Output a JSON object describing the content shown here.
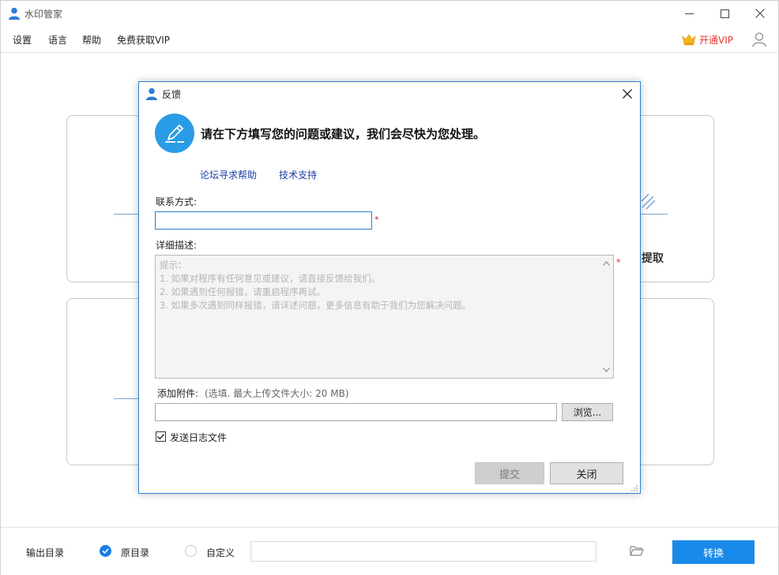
{
  "app": {
    "title": "水印管家",
    "menu": [
      "设置",
      "语言",
      "帮助",
      "免费获取VIP"
    ],
    "vip_label": "开通VIP",
    "bg_card_text": "提取"
  },
  "bottom": {
    "output_label": "输出目录",
    "option_original": "原目录",
    "option_custom": "自定义",
    "path_value": "",
    "convert_label": "转换"
  },
  "dialog": {
    "title": "反馈",
    "heading": "请在下方填写您的问题或建议，我们会尽快为您处理。",
    "links": [
      "论坛寻求帮助",
      "技术支持"
    ],
    "contact_label": "联系方式:",
    "contact_value": "",
    "required_mark": "*",
    "detail_label": "详细描述:",
    "detail_hints": [
      "提示：",
      "1. 如果对程序有任何意见或建议，请直接反馈给我们。",
      "2. 如果遇到任何报错，请重启程序再试。",
      "3. 如果多次遇到同样报错，请详述问题，更多信息有助于我们为您解决问题。"
    ],
    "attach_label": "添加附件:",
    "attach_hint": "(选填. 最大上传文件大小: 20 MB)",
    "attach_value": "",
    "browse_label": "浏览...",
    "log_label": "发送日志文件",
    "log_checked": true,
    "submit_label": "提交",
    "close_label": "关闭"
  },
  "colors": {
    "accent": "#1a8ae8",
    "vip": "#e5352c",
    "link": "#1a3fa8"
  }
}
